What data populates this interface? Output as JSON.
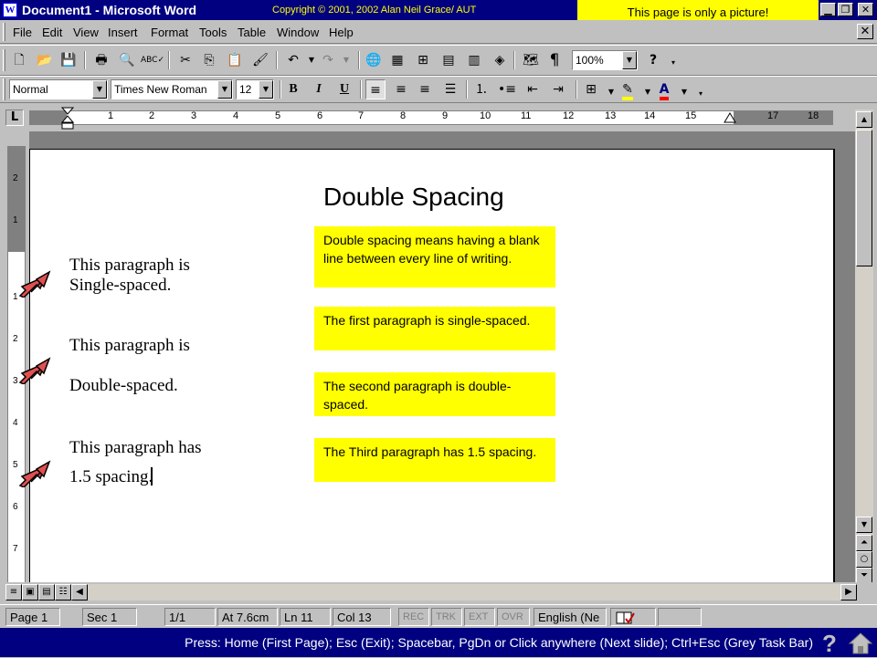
{
  "window": {
    "title": "Document1 - Microsoft Word",
    "app_icon": "W",
    "copyright": "Copyright © 2001, 2002 Alan Neil Grace/ AUT",
    "picture_note": "This page is only a picture!",
    "controls": {
      "minimize": "▁",
      "maximize": "❐",
      "close": "✕"
    }
  },
  "menu": {
    "items": [
      "File",
      "Edit",
      "View",
      "Insert",
      "Format",
      "Tools",
      "Table",
      "Window",
      "Help"
    ],
    "close": "✕"
  },
  "standard_toolbar": {
    "zoom": "100%",
    "icons": [
      "new-document-icon",
      "open-folder-icon",
      "save-icon",
      "print-icon",
      "print-preview-icon",
      "spelling-icon",
      "cut-icon",
      "copy-icon",
      "paste-icon",
      "format-painter-icon",
      "undo-icon",
      "redo-icon",
      "hyperlink-icon",
      "tables-borders-icon",
      "insert-table-icon",
      "insert-excel-icon",
      "columns-icon",
      "drawing-icon",
      "document-map-icon",
      "show-formatting-icon",
      "help-icon"
    ]
  },
  "formatting_toolbar": {
    "style": "Normal",
    "font": "Times New Roman",
    "size": "12",
    "bold": "B",
    "italic": "I",
    "underline": "U"
  },
  "ruler": {
    "corner": "L",
    "labels": [
      "1",
      "2",
      "3",
      "4",
      "5",
      "6",
      "7",
      "8",
      "9",
      "10",
      "11",
      "12",
      "13",
      "14",
      "15",
      "17",
      "18"
    ],
    "vertical_labels": [
      "2",
      "1",
      "1",
      "2",
      "3",
      "4",
      "5",
      "6",
      "7"
    ]
  },
  "document": {
    "heading": "Double Spacing",
    "samples": {
      "single": [
        "This paragraph is",
        "Single-spaced."
      ],
      "double": [
        "This paragraph is",
        "Double-spaced."
      ],
      "one_half": [
        "This paragraph has",
        "1.5 spacing."
      ]
    },
    "notes": [
      "Double spacing means having a blank line between every line of writing.",
      "The first paragraph is single-spaced.",
      "The second paragraph is double-spaced.",
      "The Third paragraph has 1.5 spacing."
    ]
  },
  "statusbar": {
    "page": "Page 1",
    "section": "Sec 1",
    "pages": "1/1",
    "at": "At 7.6cm",
    "line": "Ln 11",
    "col": "Col 13",
    "rec": "REC",
    "trk": "TRK",
    "ext": "EXT",
    "ovr": "OVR",
    "language": "English (Ne"
  },
  "instructions": {
    "text": "Press:  Home (First Page);  Esc (Exit);  Spacebar, PgDn or Click anywhere (Next slide);  Ctrl+Esc (Grey Task Bar)",
    "help": "?"
  },
  "colors": {
    "titlebar": "#000080",
    "note_background": "#ffff00",
    "arrow_fill": "#e05050"
  }
}
